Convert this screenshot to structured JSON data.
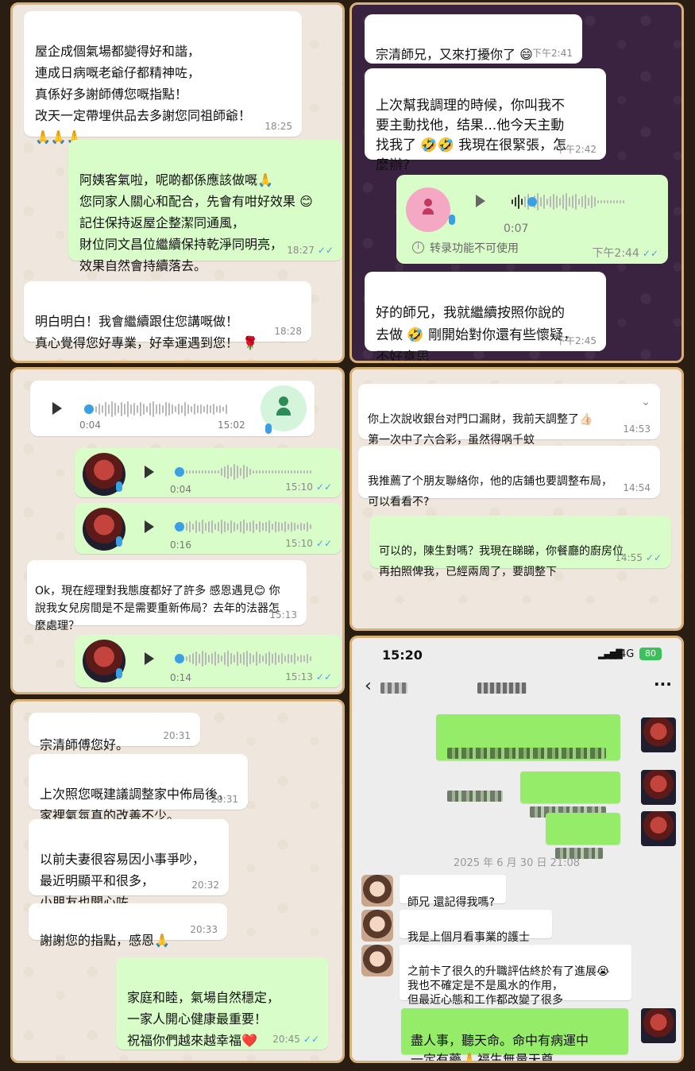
{
  "panel1": {
    "msg1": {
      "text": "屋企成個氣場都變得好和諧，\n連成日病嘅老爺仔都精神咗，\n真係好多謝師傅您嘅指點！\n改天一定帶埋供品去多謝您同祖師爺！\n🙏🙏🙏",
      "time": "18:25"
    },
    "msg2": {
      "text": "阿姨客氣啦，呢啲都係應該做嘅🙏\n您同家人關心和配合，先會有咁好效果 😊\n記住保持返屋企整潔同通風，\n財位同文昌位繼續保持乾淨同明亮，\n效果自然會持續落去。",
      "time": "18:27"
    },
    "msg3": {
      "text": "明白明白！我會繼續跟住您講嘅做！\n真心覺得您好專業，好幸運遇到您！ 🌹",
      "time": "18:28"
    }
  },
  "panel2": {
    "msg1": {
      "text": "宗清師兄，又來打擾你了 😄",
      "time": "下午2:41"
    },
    "msg2": {
      "text": "上次幫我調理的時候，你叫我不\n要主動找他，结果...他今天主動\n找我了 🤣🤣 我現在很緊張，怎\n麼辦?",
      "time": "下午2:42"
    },
    "voice": {
      "duration": "0:07",
      "note": "转录功能不可使用",
      "time": "下午2:44"
    },
    "msg3": {
      "text": "好的師兄，我就繼續按照你說的\n去做 🤣 剛開始對你還有些懷疑，\n不好意思",
      "time": "下午2:45"
    }
  },
  "panel3": {
    "voice1": {
      "duration": "0:04",
      "time": "15:02"
    },
    "voice2": {
      "duration": "0:04",
      "time": "15:10"
    },
    "voice3": {
      "duration": "0:16",
      "time": "15:10"
    },
    "msg": {
      "text": "Ok，現在經理對我態度都好了許多  感恩遇見😊 你\n說我女兒房間是不是需要重新佈局？去年的法器怎\n麼處理？",
      "time": "15:13"
    },
    "voice4": {
      "duration": "0:14",
      "time": "15:13"
    }
  },
  "panel4": {
    "msg1": {
      "text": "你上次說收銀台对門口漏財，我前天調整了👍🏻\n第一次中了六合彩，虽然得㖞千蚊",
      "time": "14:53"
    },
    "msg2": {
      "text": "我推薦了个朋友聯絡你，他的店鋪也要調整布局，\n可以看看不?",
      "time": "14:54"
    },
    "msg3": {
      "text": "可以的，陳生對嗎？我現在睇睇，你餐廳的廚房位\n再拍照俾我，已經兩周了，要調整下",
      "time": "14:55"
    }
  },
  "panel5": {
    "msg1": {
      "text": "宗清師傅您好。",
      "time": "20:31"
    },
    "msg2": {
      "text": "上次照您嘅建議調整家中佈局後，\n家裡氣氛真的改善不少。",
      "time": "20:31"
    },
    "msg3": {
      "text": "以前夫妻很容易因小事爭吵，\n最近明顯平和很多，\n小朋友也開心咗。",
      "time": "20:32"
    },
    "msg4": {
      "text": "謝謝您的指點，感恩🙏",
      "time": "20:33"
    },
    "msg5": {
      "text": "家庭和睦，氣場自然穩定，\n一家人開心健康最重要！\n祝福你們越來越幸福❤️",
      "time": "20:45"
    }
  },
  "panel6": {
    "status": {
      "clock": "15:20",
      "network": "4G",
      "battery": "80"
    },
    "date": "2025 年 6 月 30 日 21:08",
    "in1": "師兄 還記得我嗎?",
    "in2": "我是上個月看事業的護士",
    "in3": "之前卡了很久的升職評估終於有了進展😭\n我也不確定是不是風水的作用，\n但最近心態和工作都改變了很多",
    "out": "盡人事，聽天命。命中有病運中\n一定有藥🙏福生無量天尊"
  }
}
